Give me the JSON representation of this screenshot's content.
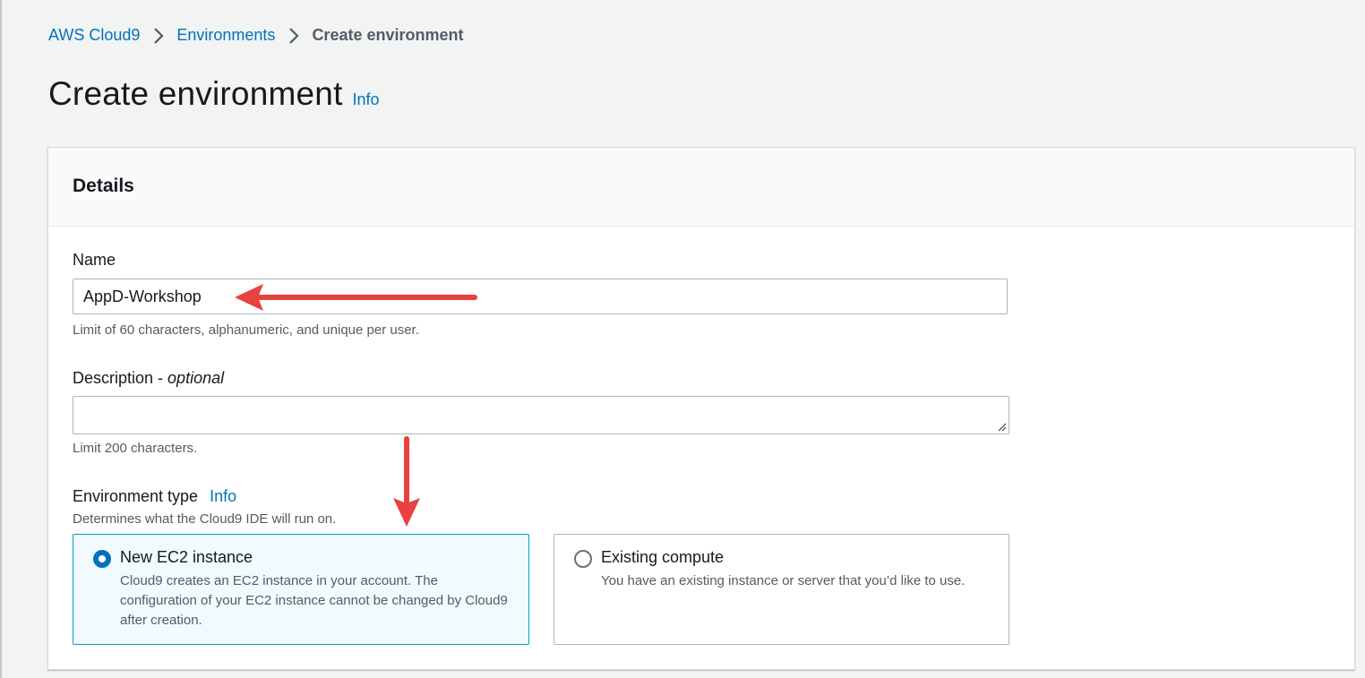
{
  "breadcrumb": {
    "items": [
      "AWS Cloud9",
      "Environments",
      "Create environment"
    ]
  },
  "page": {
    "title": "Create environment",
    "info_label": "Info"
  },
  "details": {
    "heading": "Details",
    "name": {
      "label": "Name",
      "value": "AppD-Workshop",
      "hint": "Limit of 60 characters, alphanumeric, and unique per user."
    },
    "description": {
      "label": "Description -",
      "optional": "optional",
      "value": "",
      "hint": "Limit 200 characters."
    },
    "environment_type": {
      "label": "Environment type",
      "info_label": "Info",
      "hint": "Determines what the Cloud9 IDE will run on.",
      "options": [
        {
          "title": "New EC2 instance",
          "description": "Cloud9 creates an EC2 instance in your account. The configuration of your EC2 instance cannot be changed by Cloud9 after creation.",
          "selected": true
        },
        {
          "title": "Existing compute",
          "description": "You have an existing instance or server that you’d like to use.",
          "selected": false
        }
      ]
    }
  },
  "colors": {
    "link": "#0073bb",
    "annotation_arrow": "#e8413f",
    "selected_tile_bg": "#f1faff",
    "selected_tile_border": "#00a1c9"
  }
}
